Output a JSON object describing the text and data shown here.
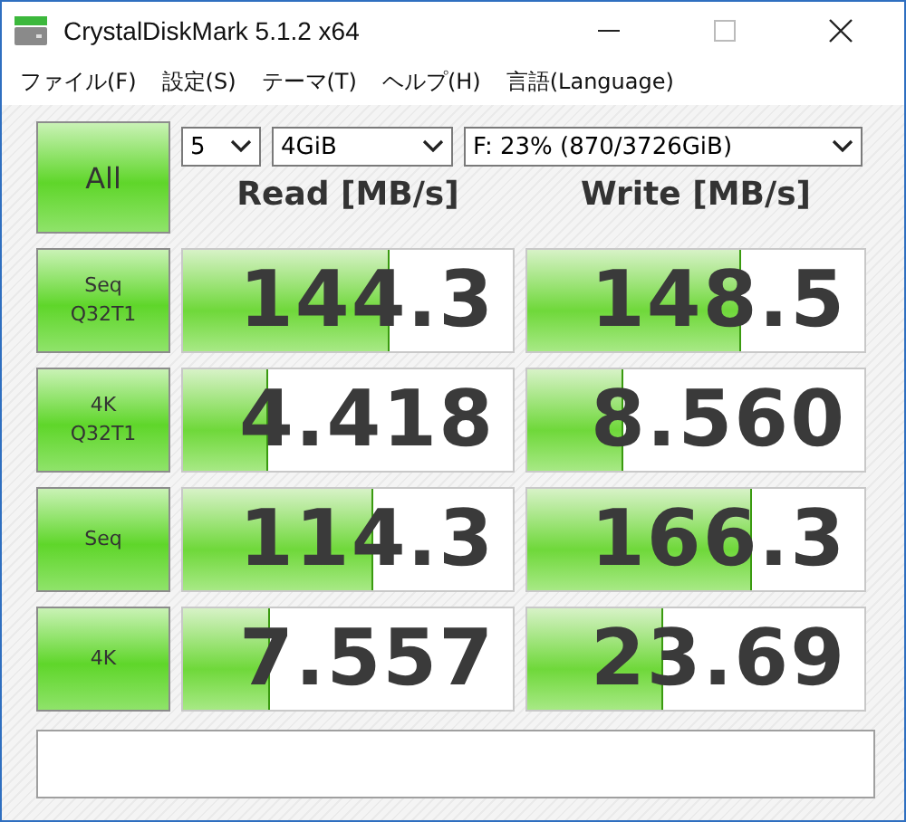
{
  "window": {
    "title": "CrystalDiskMark 5.1.2 x64"
  },
  "menu": [
    "ファイル(F)",
    "設定(S)",
    "テーマ(T)",
    "ヘルプ(H)",
    "言語(Language)"
  ],
  "all_button": "All",
  "selects": [
    {
      "value": "5",
      "kind": "count"
    },
    {
      "value": "4GiB",
      "kind": "size"
    },
    {
      "value": "F: 23% (870/3726GiB)",
      "kind": "drive"
    }
  ],
  "headers": [
    "Read [MB/s]",
    "Write [MB/s]"
  ],
  "rows": [
    {
      "test": [
        "Seq",
        "Q32T1"
      ],
      "read": {
        "value": "144.3",
        "level": 0.62
      },
      "write": {
        "value": "148.5",
        "level": 0.63
      }
    },
    {
      "test": [
        "4K",
        "Q32T1"
      ],
      "read": {
        "value": "4.418",
        "level": 0.25
      },
      "write": {
        "value": "8.560",
        "level": 0.28
      }
    },
    {
      "test": [
        "Seq"
      ],
      "read": {
        "value": "114.3",
        "level": 0.57
      },
      "write": {
        "value": "166.3",
        "level": 0.66
      }
    },
    {
      "test": [
        "4K"
      ],
      "read": {
        "value": "7.557",
        "level": 0.26
      },
      "write": {
        "value": "23.69",
        "level": 0.4
      }
    }
  ]
}
